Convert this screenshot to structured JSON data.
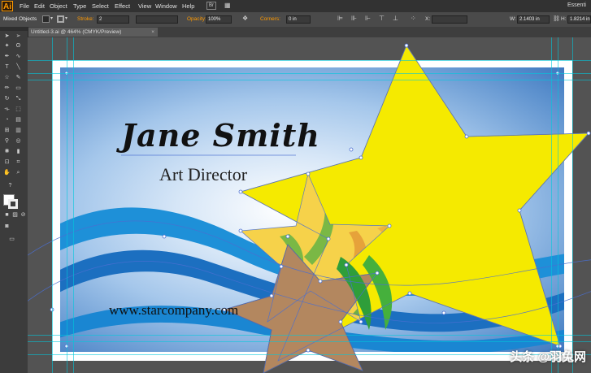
{
  "app": {
    "logo": "Ai",
    "workspace": "Essenti"
  },
  "menu": [
    "File",
    "Edit",
    "Object",
    "Type",
    "Select",
    "Effect",
    "View",
    "Window",
    "Help"
  ],
  "control_bar": {
    "selection_label": "Mixed Objects",
    "stroke_label": "Stroke:",
    "stroke_value": "2",
    "opacity_label": "Opacity:",
    "opacity_value": "100%",
    "corners_label": "Corners:",
    "corners_value": "0 in",
    "x_label": "X:",
    "w_label": "W:",
    "w_value": "2.1403 in",
    "h_label": "H:",
    "h_value": "1.8214 in"
  },
  "document_tab": {
    "title": "Untitled-3.ai @ 464% (CMYK/Preview)"
  },
  "card": {
    "name": "Jane Smith",
    "role": "Art Director",
    "website": "www.starcompany.com"
  },
  "colors": {
    "accent": "#ff9a00",
    "star_yellow": "#f5ea00",
    "star_tan": "#b3875f",
    "wave_blue": "#1e90d8",
    "guide": "#00c8dc",
    "selection": "#4a6fd1"
  },
  "watermark": "头条 @羽兔网"
}
